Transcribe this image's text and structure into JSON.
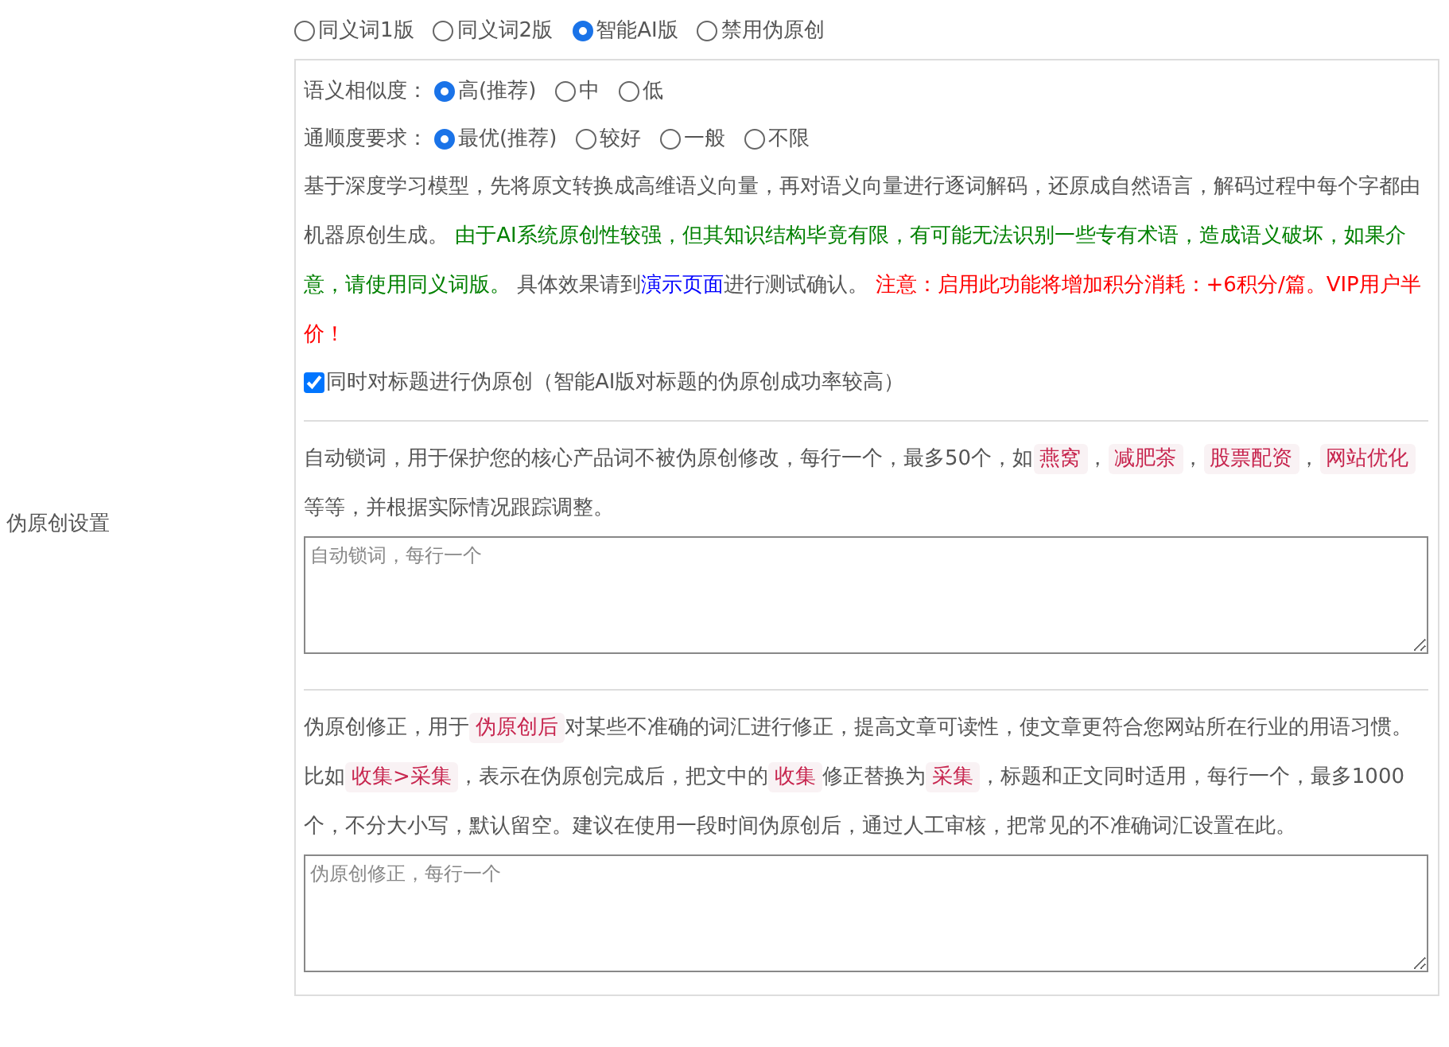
{
  "section_label": "伪原创设置",
  "mode_options": [
    {
      "label": "同义词1版",
      "selected": false
    },
    {
      "label": "同义词2版",
      "selected": false
    },
    {
      "label": "智能AI版",
      "selected": true
    },
    {
      "label": "禁用伪原创",
      "selected": false
    }
  ],
  "similarity": {
    "label": "语义相似度：",
    "options": [
      {
        "label": "高(推荐)",
        "selected": true
      },
      {
        "label": "中",
        "selected": false
      },
      {
        "label": "低",
        "selected": false
      }
    ]
  },
  "fluency": {
    "label": "通顺度要求：",
    "options": [
      {
        "label": "最优(推荐)",
        "selected": true
      },
      {
        "label": "较好",
        "selected": false
      },
      {
        "label": "一般",
        "selected": false
      },
      {
        "label": "不限",
        "selected": false
      }
    ]
  },
  "description": [
    {
      "kind": "plain",
      "text": "基于深度学习模型，先将原文转换成高维语义向量，再对语义向量进行逐词解码，还原成自然语言，解码过程中每个字都由机器原创生成。 "
    },
    {
      "kind": "green",
      "text": "由于AI系统原创性较强，但其知识结构毕竟有限，有可能无法识别一些专有术语，造成语义破坏，如果介意，请使用同义词版。"
    },
    {
      "kind": "plain",
      "text": " 具体效果请到"
    },
    {
      "kind": "link",
      "text": "演示页面"
    },
    {
      "kind": "plain",
      "text": "进行测试确认。 "
    },
    {
      "kind": "red",
      "text": "注意：启用此功能将增加积分消耗：+6积分/篇。VIP用户半价！"
    }
  ],
  "title_option": {
    "label": "同时对标题进行伪原创（智能AI版对标题的伪原创成功率较高）",
    "checked": true
  },
  "lock_words": {
    "description": [
      {
        "kind": "plain",
        "text": "自动锁词，用于保护您的核心产品词不被伪原创修改，每行一个，最多50个，如"
      },
      {
        "kind": "code",
        "text": "燕窝"
      },
      {
        "kind": "plain",
        "text": "，"
      },
      {
        "kind": "code",
        "text": "减肥茶"
      },
      {
        "kind": "plain",
        "text": "，"
      },
      {
        "kind": "code",
        "text": "股票配资"
      },
      {
        "kind": "plain",
        "text": "，"
      },
      {
        "kind": "code",
        "text": "网站优化"
      },
      {
        "kind": "plain",
        "text": " 等等，并根据实际情况跟踪调整。"
      }
    ],
    "placeholder": "自动锁词，每行一个"
  },
  "correction": {
    "description": [
      {
        "kind": "plain",
        "text": "伪原创修正，用于"
      },
      {
        "kind": "code",
        "text": "伪原创后"
      },
      {
        "kind": "plain",
        "text": "对某些不准确的词汇进行修正，提高文章可读性，使文章更符合您网站所在行业的用语习惯。比如"
      },
      {
        "kind": "code",
        "text": "收集>采集"
      },
      {
        "kind": "plain",
        "text": "，表示在伪原创完成后，把文中的"
      },
      {
        "kind": "code",
        "text": "收集"
      },
      {
        "kind": "plain",
        "text": "修正替换为"
      },
      {
        "kind": "code",
        "text": "采集"
      },
      {
        "kind": "plain",
        "text": "，标题和正文同时适用，每行一个，最多1000个，不分大小写，默认留空。建议在使用一段时间伪原创后，通过人工审核，把常见的不准确词汇设置在此。"
      }
    ],
    "placeholder": "伪原创修正，每行一个"
  }
}
